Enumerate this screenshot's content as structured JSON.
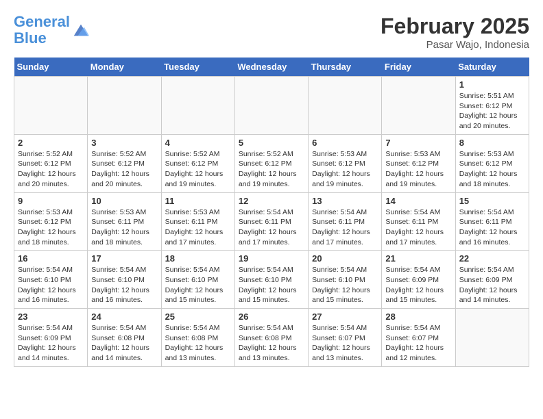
{
  "header": {
    "logo_line1": "General",
    "logo_line2": "Blue",
    "month_title": "February 2025",
    "location": "Pasar Wajo, Indonesia"
  },
  "weekdays": [
    "Sunday",
    "Monday",
    "Tuesday",
    "Wednesday",
    "Thursday",
    "Friday",
    "Saturday"
  ],
  "weeks": [
    [
      {
        "day": "",
        "info": ""
      },
      {
        "day": "",
        "info": ""
      },
      {
        "day": "",
        "info": ""
      },
      {
        "day": "",
        "info": ""
      },
      {
        "day": "",
        "info": ""
      },
      {
        "day": "",
        "info": ""
      },
      {
        "day": "1",
        "info": "Sunrise: 5:51 AM\nSunset: 6:12 PM\nDaylight: 12 hours\nand 20 minutes."
      }
    ],
    [
      {
        "day": "2",
        "info": "Sunrise: 5:52 AM\nSunset: 6:12 PM\nDaylight: 12 hours\nand 20 minutes."
      },
      {
        "day": "3",
        "info": "Sunrise: 5:52 AM\nSunset: 6:12 PM\nDaylight: 12 hours\nand 20 minutes."
      },
      {
        "day": "4",
        "info": "Sunrise: 5:52 AM\nSunset: 6:12 PM\nDaylight: 12 hours\nand 19 minutes."
      },
      {
        "day": "5",
        "info": "Sunrise: 5:52 AM\nSunset: 6:12 PM\nDaylight: 12 hours\nand 19 minutes."
      },
      {
        "day": "6",
        "info": "Sunrise: 5:53 AM\nSunset: 6:12 PM\nDaylight: 12 hours\nand 19 minutes."
      },
      {
        "day": "7",
        "info": "Sunrise: 5:53 AM\nSunset: 6:12 PM\nDaylight: 12 hours\nand 19 minutes."
      },
      {
        "day": "8",
        "info": "Sunrise: 5:53 AM\nSunset: 6:12 PM\nDaylight: 12 hours\nand 18 minutes."
      }
    ],
    [
      {
        "day": "9",
        "info": "Sunrise: 5:53 AM\nSunset: 6:12 PM\nDaylight: 12 hours\nand 18 minutes."
      },
      {
        "day": "10",
        "info": "Sunrise: 5:53 AM\nSunset: 6:11 PM\nDaylight: 12 hours\nand 18 minutes."
      },
      {
        "day": "11",
        "info": "Sunrise: 5:53 AM\nSunset: 6:11 PM\nDaylight: 12 hours\nand 17 minutes."
      },
      {
        "day": "12",
        "info": "Sunrise: 5:54 AM\nSunset: 6:11 PM\nDaylight: 12 hours\nand 17 minutes."
      },
      {
        "day": "13",
        "info": "Sunrise: 5:54 AM\nSunset: 6:11 PM\nDaylight: 12 hours\nand 17 minutes."
      },
      {
        "day": "14",
        "info": "Sunrise: 5:54 AM\nSunset: 6:11 PM\nDaylight: 12 hours\nand 17 minutes."
      },
      {
        "day": "15",
        "info": "Sunrise: 5:54 AM\nSunset: 6:11 PM\nDaylight: 12 hours\nand 16 minutes."
      }
    ],
    [
      {
        "day": "16",
        "info": "Sunrise: 5:54 AM\nSunset: 6:10 PM\nDaylight: 12 hours\nand 16 minutes."
      },
      {
        "day": "17",
        "info": "Sunrise: 5:54 AM\nSunset: 6:10 PM\nDaylight: 12 hours\nand 16 minutes."
      },
      {
        "day": "18",
        "info": "Sunrise: 5:54 AM\nSunset: 6:10 PM\nDaylight: 12 hours\nand 15 minutes."
      },
      {
        "day": "19",
        "info": "Sunrise: 5:54 AM\nSunset: 6:10 PM\nDaylight: 12 hours\nand 15 minutes."
      },
      {
        "day": "20",
        "info": "Sunrise: 5:54 AM\nSunset: 6:10 PM\nDaylight: 12 hours\nand 15 minutes."
      },
      {
        "day": "21",
        "info": "Sunrise: 5:54 AM\nSunset: 6:09 PM\nDaylight: 12 hours\nand 15 minutes."
      },
      {
        "day": "22",
        "info": "Sunrise: 5:54 AM\nSunset: 6:09 PM\nDaylight: 12 hours\nand 14 minutes."
      }
    ],
    [
      {
        "day": "23",
        "info": "Sunrise: 5:54 AM\nSunset: 6:09 PM\nDaylight: 12 hours\nand 14 minutes."
      },
      {
        "day": "24",
        "info": "Sunrise: 5:54 AM\nSunset: 6:08 PM\nDaylight: 12 hours\nand 14 minutes."
      },
      {
        "day": "25",
        "info": "Sunrise: 5:54 AM\nSunset: 6:08 PM\nDaylight: 12 hours\nand 13 minutes."
      },
      {
        "day": "26",
        "info": "Sunrise: 5:54 AM\nSunset: 6:08 PM\nDaylight: 12 hours\nand 13 minutes."
      },
      {
        "day": "27",
        "info": "Sunrise: 5:54 AM\nSunset: 6:07 PM\nDaylight: 12 hours\nand 13 minutes."
      },
      {
        "day": "28",
        "info": "Sunrise: 5:54 AM\nSunset: 6:07 PM\nDaylight: 12 hours\nand 12 minutes."
      },
      {
        "day": "",
        "info": ""
      }
    ]
  ]
}
